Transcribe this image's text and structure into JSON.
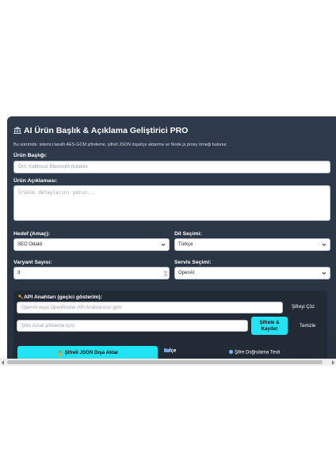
{
  "title": "AI Ürün Başlık & Açıklama Geliştirici PRO",
  "description": "Bu sürümde: istemci taraflı AES-GCM şifreleme, şifreli JSON dışa/içe aktarma ve Node.js proxy örneği bulunur.",
  "product_title": {
    "label": "Ürün Başlığı:",
    "placeholder": "Örn: Kablosuz Bluetooth Kulaklık"
  },
  "product_desc": {
    "label": "Ürün Açıklaması:",
    "placeholder": "Ürünün detaylarını yazın..."
  },
  "goal": {
    "label": "Hedef (Amaç):",
    "selected": "SEO Odaklı"
  },
  "language": {
    "label": "Dil Seçimi:",
    "selected": "Türkçe"
  },
  "variants": {
    "label": "Varyant Sayısı:",
    "value": "3"
  },
  "service": {
    "label": "Servis Seçimi:",
    "selected": "OpenAI"
  },
  "api": {
    "title": "API Anahtarı (geçici gösterim):",
    "key_placeholder": "OpenAI veya OpenRouter API Anahtarınızı girin",
    "decrypt_label": "Şifreyi Çöz",
    "password_placeholder": "Şifre (local şifreleme için)",
    "encrypt_save_label": "Şifrele & Kaydet",
    "clear_label": "Temizle",
    "export_label": "Şifreli JSON Dışa Aktar",
    "import_label": "İçe",
    "test_label": "Şifre Doğrulama Testi"
  },
  "colors": {
    "panel": "#2f3b4d",
    "accent": "#22e3f3",
    "text": "#ffffff"
  },
  "icons": {
    "title": "bank-icon",
    "key": "key-icon",
    "export": "lock-icon",
    "import": "folder-icon",
    "test": "dot-icon"
  }
}
